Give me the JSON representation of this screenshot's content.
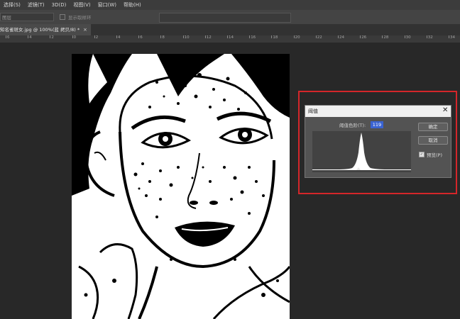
{
  "menu": [
    {
      "label": "选择(S)"
    },
    {
      "label": "滤镜(T)"
    },
    {
      "label": "3D(D)"
    },
    {
      "label": "视图(V)"
    },
    {
      "label": "窗口(W)"
    },
    {
      "label": "帮助(H)"
    }
  ],
  "options_bar": {
    "field_value": "图层",
    "option_label": "显示取样环"
  },
  "document_tab": {
    "title": "知名雀斑女.jpg @ 100%(蓝 拷贝/8) *",
    "close": "×"
  },
  "ruler": {
    "marks": [
      "6",
      "4",
      "2",
      "0",
      "2",
      "4",
      "6",
      "8",
      "10",
      "12",
      "14",
      "16",
      "18",
      "20",
      "22",
      "24",
      "26",
      "28",
      "30",
      "32",
      "34"
    ]
  },
  "dialog": {
    "title": "阈值",
    "close": "✕",
    "level_label": "阈值色阶(T):",
    "level_value": "119",
    "ok_label": "确定",
    "cancel_label": "取消",
    "preview_label": "预览(P)",
    "preview_checked": true
  },
  "colors": {
    "highlight_border": "#d4262a",
    "value_highlight": "#3a63d1"
  }
}
